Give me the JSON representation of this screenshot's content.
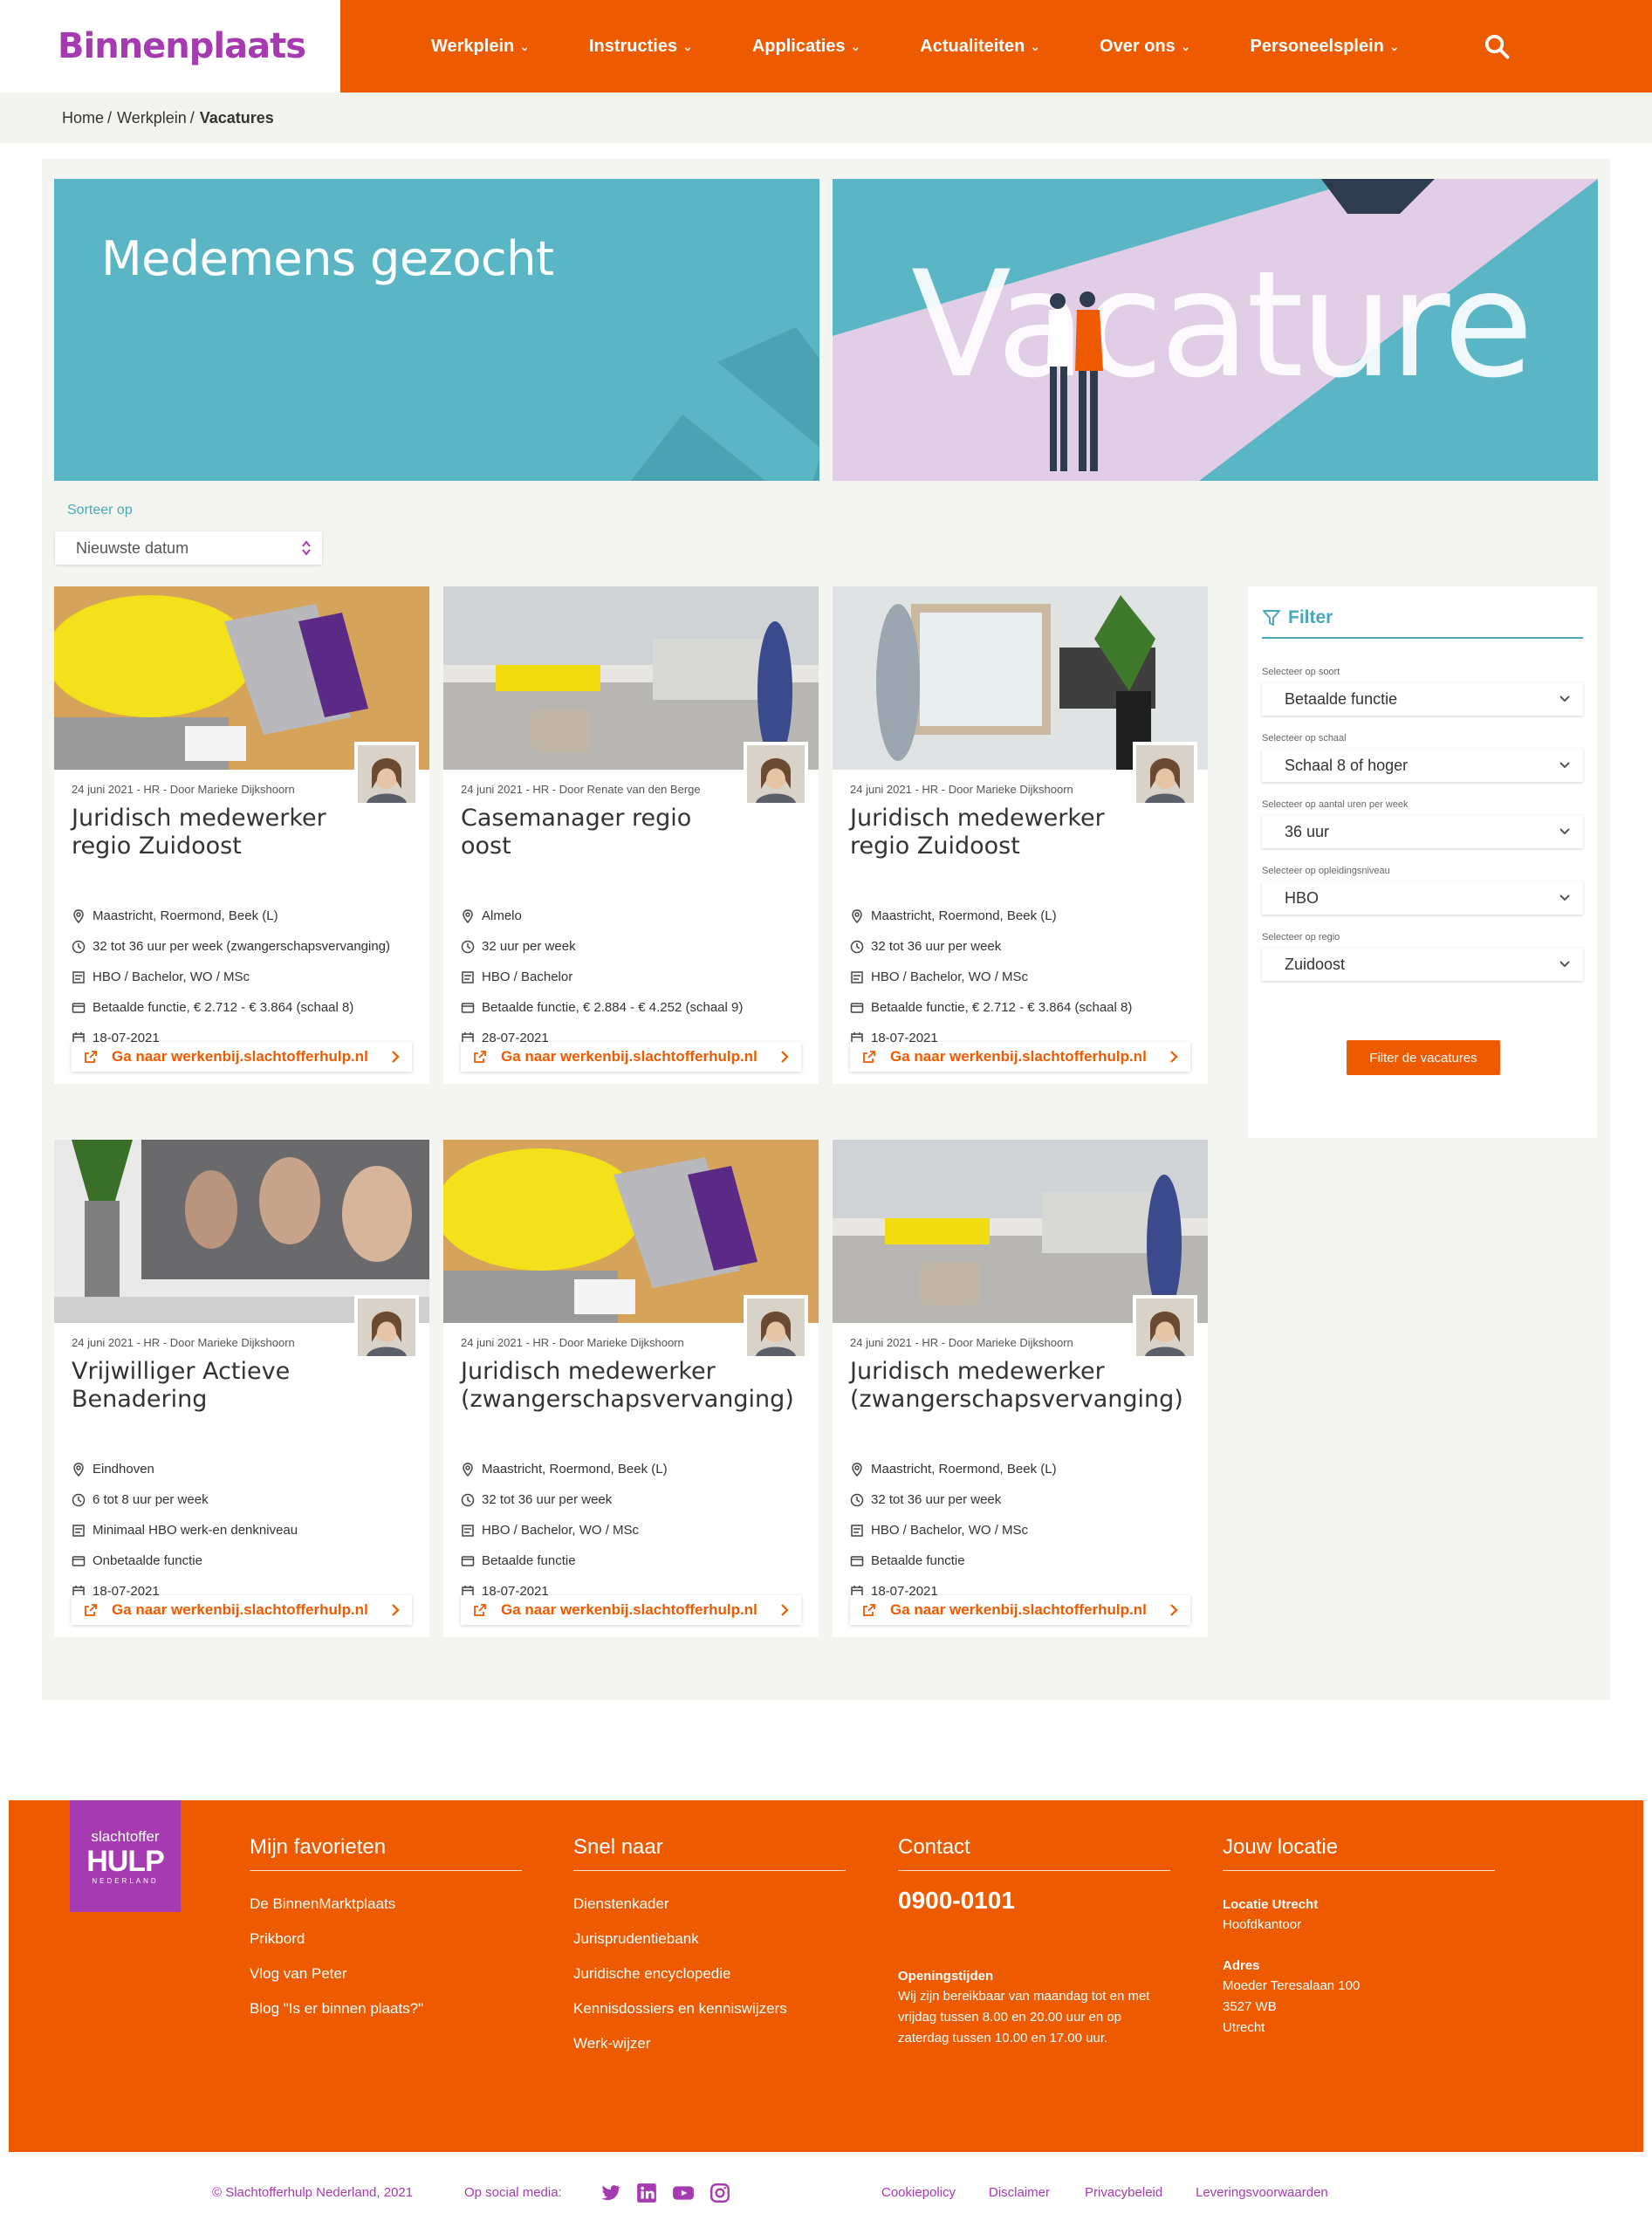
{
  "brand": {
    "name": "Binnenplaats"
  },
  "nav": {
    "items": [
      {
        "label": "Werkplein"
      },
      {
        "label": "Instructies"
      },
      {
        "label": "Applicaties"
      },
      {
        "label": "Actualiteiten"
      },
      {
        "label": "Over ons"
      },
      {
        "label": "Personeelsplein"
      }
    ]
  },
  "breadcrumb": {
    "home": "Home",
    "sep1": "/",
    "section": "Werkplein",
    "sep2": "/",
    "current": "Vacatures"
  },
  "hero": {
    "left_title": "Medemens gezocht",
    "right_word": "Vacature"
  },
  "sort": {
    "label": "Sorteer op",
    "value": "Nieuwste datum"
  },
  "cards": [
    {
      "meta": "24 juni 2021 - HR - Door Marieke Dijkshoorn",
      "title": "Juridisch medewerker regio Zuidoost",
      "location": "Maastricht, Roermond, Beek (L)",
      "hours": "32 tot 36 uur per week (zwangerschapsvervanging)",
      "education": "HBO / Bachelor, WO / MSc",
      "salary": "Betaalde functie, € 2.712 - € 3.864 (schaal 8)",
      "deadline": "18-07-2021",
      "cta": "Ga naar werkenbij.slachtofferhulp.nl"
    },
    {
      "meta": "24 juni 2021 - HR - Door Renate van den Berge",
      "title": "Casemanager regio oost",
      "location": "Almelo",
      "hours": "32 uur per week",
      "education": "HBO / Bachelor",
      "salary": "Betaalde functie, € 2.884 - € 4.252 (schaal 9)",
      "deadline": "28-07-2021",
      "cta": "Ga naar werkenbij.slachtofferhulp.nl"
    },
    {
      "meta": "24 juni 2021 - HR - Door Marieke Dijkshoorn",
      "title": "Juridisch medewerker regio Zuidoost",
      "location": "Maastricht, Roermond, Beek (L)",
      "hours": "32 tot 36 uur per week",
      "education": "HBO / Bachelor, WO / MSc",
      "salary": "Betaalde functie, € 2.712 - € 3.864 (schaal 8)",
      "deadline": "18-07-2021",
      "cta": "Ga naar werkenbij.slachtofferhulp.nl"
    },
    {
      "meta": "24 juni 2021 - HR - Door Marieke Dijkshoorn",
      "title": "Vrijwilliger Actieve Benadering",
      "location": "Eindhoven",
      "hours": "6 tot 8 uur per week",
      "education": "Minimaal HBO werk-en denkniveau",
      "salary": "Onbetaalde functie",
      "deadline": "18-07-2021",
      "cta": "Ga naar werkenbij.slachtofferhulp.nl"
    },
    {
      "meta": "24 juni 2021 - HR - Door Marieke Dijkshoorn",
      "title": "Juridisch medewerker (zwangerschapsvervanging)",
      "location": "Maastricht, Roermond, Beek (L)",
      "hours": "32 tot 36 uur per week",
      "education": "HBO / Bachelor, WO / MSc",
      "salary": "Betaalde functie",
      "deadline": "18-07-2021",
      "cta": "Ga naar werkenbij.slachtofferhulp.nl"
    },
    {
      "meta": "24 juni 2021 - HR - Door Marieke Dijkshoorn",
      "title": "Juridisch medewerker (zwangerschapsvervanging)",
      "location": "Maastricht, Roermond, Beek (L)",
      "hours": "32 tot 36 uur per week",
      "education": "HBO / Bachelor, WO / MSc",
      "salary": "Betaalde functie",
      "deadline": "18-07-2021",
      "cta": "Ga naar werkenbij.slachtofferhulp.nl"
    }
  ],
  "filter": {
    "title": "Filter",
    "groups": [
      {
        "label": "Selecteer op soort",
        "value": "Betaalde functie"
      },
      {
        "label": "Selecteer op schaal",
        "value": "Schaal 8 of hoger"
      },
      {
        "label": "Selecteer op aantal uren per week",
        "value": "36 uur"
      },
      {
        "label": "Selecteer op opleidingsniveau",
        "value": "HBO"
      },
      {
        "label": "Selecteer op regio",
        "value": "Zuidoost"
      }
    ],
    "button": "Filter de vacatures"
  },
  "footer": {
    "logo": {
      "line1": "slachtoffer",
      "line2": "HULP",
      "line3": "NEDERLAND"
    },
    "favorites": {
      "title": "Mijn favorieten",
      "links": [
        "De BinnenMarktplaats",
        "Prikbord",
        "Vlog van Peter",
        "Blog \"Is er binnen plaats?\""
      ]
    },
    "quick": {
      "title": "Snel naar",
      "links": [
        "Dienstenkader",
        "Jurisprudentiebank",
        "Juridische encyclopedie",
        "Kennisdossiers en kenniswijzers",
        "Werk-wijzer"
      ]
    },
    "contact": {
      "title": "Contact",
      "phone": "0900-0101",
      "hours_title": "Openingstijden",
      "hours_text": "Wij zijn bereikbaar van maandag tot en met vrijdag tussen 8.00 en 20.00 uur en op zaterdag tussen 10.00 en 17.00 uur."
    },
    "location": {
      "title": "Jouw locatie",
      "loc_name": "Locatie Utrecht",
      "loc_sub": "Hoofdkantoor",
      "addr_title": "Adres",
      "street": "Moeder Teresalaan 100",
      "zip": "3527 WB",
      "city": "Utrecht"
    }
  },
  "bottom": {
    "copyright": "© Slachtofferhulp Nederland, 2021",
    "social_label": "Op social media:",
    "social": [
      "twitter-icon",
      "linkedin-icon",
      "youtube-icon",
      "instagram-icon"
    ],
    "links": [
      "Cookiepolicy",
      "Disclaimer",
      "Privacybeleid",
      "Leveringsvoorwaarden"
    ]
  },
  "colors": {
    "orange": "#ee5a00",
    "purple": "#a63bb1",
    "teal": "#5ab6c5",
    "panel": "#f4f4f0"
  }
}
